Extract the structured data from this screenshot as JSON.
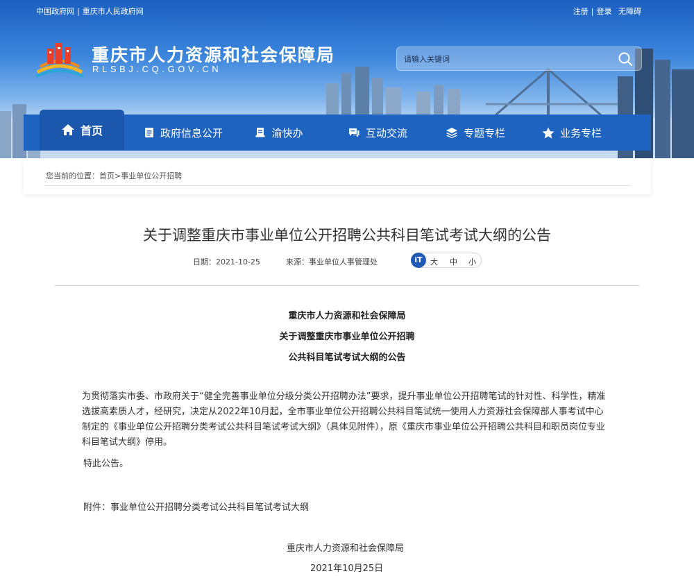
{
  "topbar": {
    "links_left": [
      "中国政府网",
      "重庆市人民政府网"
    ],
    "separator": "|",
    "links_right": [
      "注册",
      "登录",
      "无障碍"
    ]
  },
  "header": {
    "title": "重庆市人力资源和社会保障局",
    "subtitle": "RLSBJ.CQ.GOV.CN",
    "search_placeholder": "请输入关键词"
  },
  "nav": {
    "items": [
      {
        "label": "首页",
        "icon": "home-icon"
      },
      {
        "label": "政府信息公开",
        "icon": "document-icon"
      },
      {
        "label": "渝快办",
        "icon": "book-icon"
      },
      {
        "label": "互动交流",
        "icon": "chat-icon"
      },
      {
        "label": "专题专栏",
        "icon": "layers-icon"
      },
      {
        "label": "业务专栏",
        "icon": "star-icon"
      }
    ]
  },
  "breadcrumb": {
    "prefix": "您当前的位置：",
    "home": "首页",
    "arrow": ">",
    "current": "事业单位公开招聘"
  },
  "article": {
    "title": "关于调整重庆市事业单位公开招聘公共科目笔试考试大纲的公告",
    "date_label": "日期：",
    "date": "2021-10-25",
    "source_label": "来源：",
    "source": "事业单位人事管理处",
    "font_icon": "iT",
    "font_sizes": [
      "大",
      "中",
      "小"
    ],
    "headline": [
      "重庆市人力资源和社会保障局",
      "关于调整重庆市事业单位公开招聘",
      "公共科目笔试考试大纲的公告"
    ],
    "paragraph": "为贯彻落实市委、市政府关于“健全完善事业单位分级分类公开招聘办法”要求，提升事业单位公开招聘笔试的针对性、科学性，精准选拔高素质人才，经研究，决定从2022年10月起，全市事业单位公开招聘公共科目笔试统一使用人力资源社会保障部人事考试中心制定的《事业单位公开招聘分类考试公共科目笔试考试大纲》（具体见附件），原《重庆市事业单位公开招聘公共科目和职员岗位专业科目笔试大纲》停用。",
    "special": "特此公告。",
    "attachment": "附件：事业单位公开招聘分类考试公共科目笔试考试大纲",
    "signature_org": "重庆市人力资源和社会保障局",
    "signature_date": "2021年10月25日"
  },
  "colors": {
    "nav_bg": "#1e63bf",
    "nav_active": "#1a57ad",
    "font_icon_bg": "#1f5ab5"
  }
}
